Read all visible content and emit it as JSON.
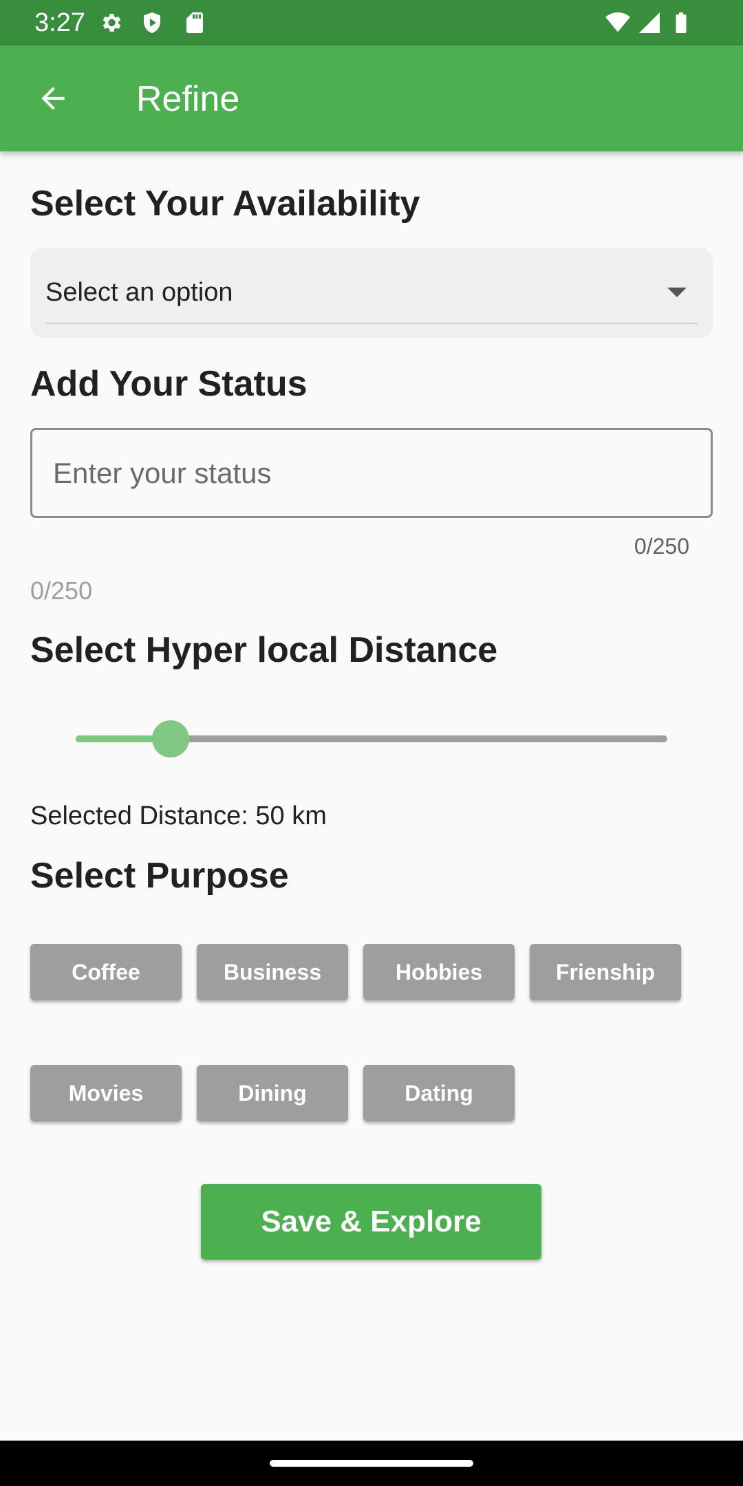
{
  "status_bar": {
    "time": "3:27",
    "icons_left": [
      "gear-icon",
      "shield-icon",
      "sd-card-icon"
    ],
    "icons_right": [
      "wifi-icon",
      "signal-icon",
      "battery-icon"
    ]
  },
  "app_bar": {
    "back_icon": "arrow-back-icon",
    "title": "Refine"
  },
  "availability": {
    "title": "Select Your Availability",
    "dropdown_value": "Select an option"
  },
  "status": {
    "title": "Add Your Status",
    "placeholder": "Enter your status",
    "value": "",
    "counter_right": "0/250",
    "counter_left": "0/250"
  },
  "distance": {
    "title": "Select Hyper local Distance",
    "slider_fraction": 0.16,
    "selected_text": "Selected Distance: 50 km"
  },
  "purpose": {
    "title": "Select Purpose",
    "chips": [
      "Coffee",
      "Business",
      "Hobbies",
      "Frienship",
      "Movies",
      "Dining",
      "Dating"
    ]
  },
  "save_button": "Save & Explore",
  "colors": {
    "primary": "#4caf50",
    "primary_dark": "#388e3c",
    "slider_active": "#81c784",
    "chip": "#9e9e9e"
  }
}
